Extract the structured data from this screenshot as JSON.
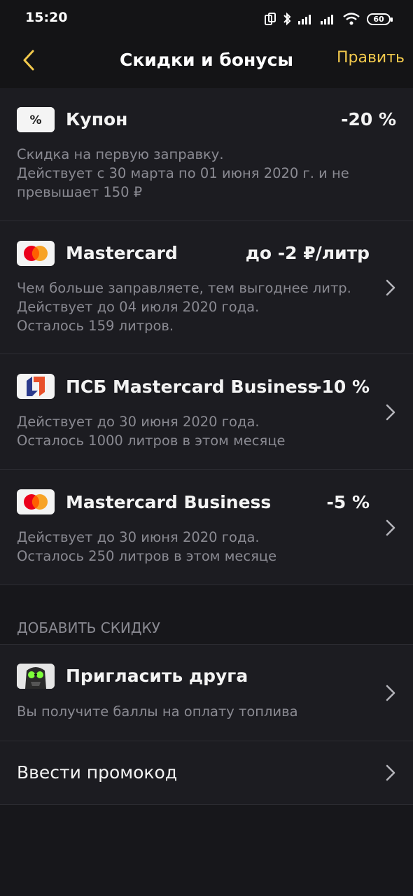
{
  "status": {
    "time": "15:20",
    "battery": "60"
  },
  "header": {
    "title": "Скидки и бонусы",
    "edit_label": "Править"
  },
  "discounts": [
    {
      "icon": "coupon-percent-icon",
      "title": "Купон",
      "value": "-20 %",
      "desc_lines": [
        "Скидка на первую заправку.",
        "Действует с 30 марта по 01 июня 2020 г. и не",
        "превышает 150 ₽"
      ]
    },
    {
      "icon": "mastercard-icon",
      "title": "Mastercard",
      "value": "до -2 ₽/литр",
      "desc_lines": [
        "Чем больше заправляете, тем выгоднее литр.",
        "Действует до 04 июля 2020 года.",
        "Осталось 159 литров."
      ]
    },
    {
      "icon": "psb-logo-icon",
      "title": "ПСБ Mastercard Business",
      "value": "-10 %",
      "desc_lines": [
        "Действует до 30 июня 2020 года.",
        "Осталось 1000 литров в этом месяце"
      ]
    },
    {
      "icon": "mastercard-icon",
      "title": "Mastercard Business",
      "value": "-5 %",
      "desc_lines": [
        "Действует до 30 июня 2020 года.",
        "Осталось 250 литров в этом месяце"
      ]
    }
  ],
  "add_section": {
    "header": "ДОБАВИТЬ СКИДКУ",
    "invite": {
      "title": "Пригласить друга",
      "desc": "Вы получите баллы на оплату топлива"
    },
    "promo": {
      "title": "Ввести промокод"
    }
  },
  "colors": {
    "accent": "#f2c94c",
    "background": "#17171b",
    "card": "#1c1c21",
    "muted_text": "#8a8a92"
  }
}
